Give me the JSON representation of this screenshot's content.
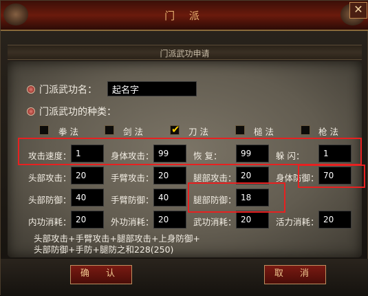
{
  "window": {
    "title": "门 派",
    "close_glyph": "✕"
  },
  "subtitle": "门派武功申请",
  "skill_name": {
    "label": "门派武功名：",
    "value": "起名字"
  },
  "skill_type": {
    "label": "门派武功的种类：",
    "options": [
      {
        "label": "拳 法",
        "checked": false
      },
      {
        "label": "剑 法",
        "checked": false
      },
      {
        "label": "刀 法",
        "checked": true
      },
      {
        "label": "槌 法",
        "checked": false
      },
      {
        "label": "枪 法",
        "checked": false
      }
    ]
  },
  "stats": {
    "attack_speed": {
      "label": "攻击速度：",
      "value": "1"
    },
    "body_attack": {
      "label": "身体攻击：",
      "value": "99"
    },
    "recover": {
      "label": "恢    复：",
      "value": "99"
    },
    "dodge": {
      "label": "躲    闪：",
      "value": "1"
    },
    "head_attack": {
      "label": "头部攻击：",
      "value": "20"
    },
    "arm_attack": {
      "label": "手臂攻击：",
      "value": "20"
    },
    "leg_attack": {
      "label": "腿部攻击：",
      "value": "20"
    },
    "body_defense": {
      "label": "身体防御：",
      "value": "70"
    },
    "head_defense": {
      "label": "头部防御：",
      "value": "40"
    },
    "arm_defense": {
      "label": "手臂防御：",
      "value": "40"
    },
    "leg_defense": {
      "label": "腿部防御：",
      "value": "18"
    },
    "inner_cost": {
      "label": "内功消耗：",
      "value": "20"
    },
    "outer_cost": {
      "label": "外功消耗：",
      "value": "20"
    },
    "martial_cost": {
      "label": "武功消耗：",
      "value": "20"
    },
    "vitality_cost": {
      "label": "活力消耗：",
      "value": "20"
    }
  },
  "notes": {
    "line1": "头部攻击+手臂攻击+腿部攻击+上身防御+",
    "line2": "头部防御+手防+腿防之和228(250)"
  },
  "buttons": {
    "confirm": "确 认",
    "cancel": "取 消"
  },
  "colors": {
    "highlight": "#e82020",
    "check": "#ffd000",
    "title": "#e8b070"
  }
}
